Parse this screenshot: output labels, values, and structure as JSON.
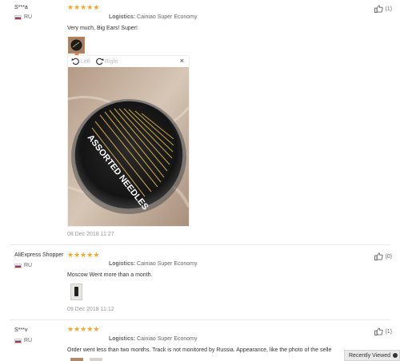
{
  "reviews": [
    {
      "user": "S***a",
      "country": "RU",
      "logistics_label": "Logistics:",
      "logistics_value": "Cainiao Super Economy",
      "comment": "Very much, Big Ears! Super!",
      "date": "08 Dec 2018 11:27",
      "helpful": "(1)",
      "rating": 5
    },
    {
      "user": "AliExpress Shopper",
      "country": "RU",
      "logistics_label": "Logistics:",
      "logistics_value": "Cainiao Super Economy",
      "comment": "Moscow Went more than a month.",
      "date": "09 Dec 2018 11:12",
      "helpful": "(0)",
      "rating": 5
    },
    {
      "user": "S***v",
      "country": "RU",
      "logistics_label": "Logistics:",
      "logistics_value": "Cainiao Super Economy",
      "comment": "Order went less than two months. Track is not monitored by Russia. Appearance, like the photo of the selle",
      "helpful": "(1)",
      "rating": 5
    }
  ],
  "viewer": {
    "rotate_left": "Left",
    "rotate_right": "Right",
    "close": "×",
    "photo_text": "ASSORTED NEEDLES"
  },
  "recently_viewed": "Recently Viewed",
  "colors": {
    "star": "#f5a623",
    "accent": "#e07a3b"
  }
}
